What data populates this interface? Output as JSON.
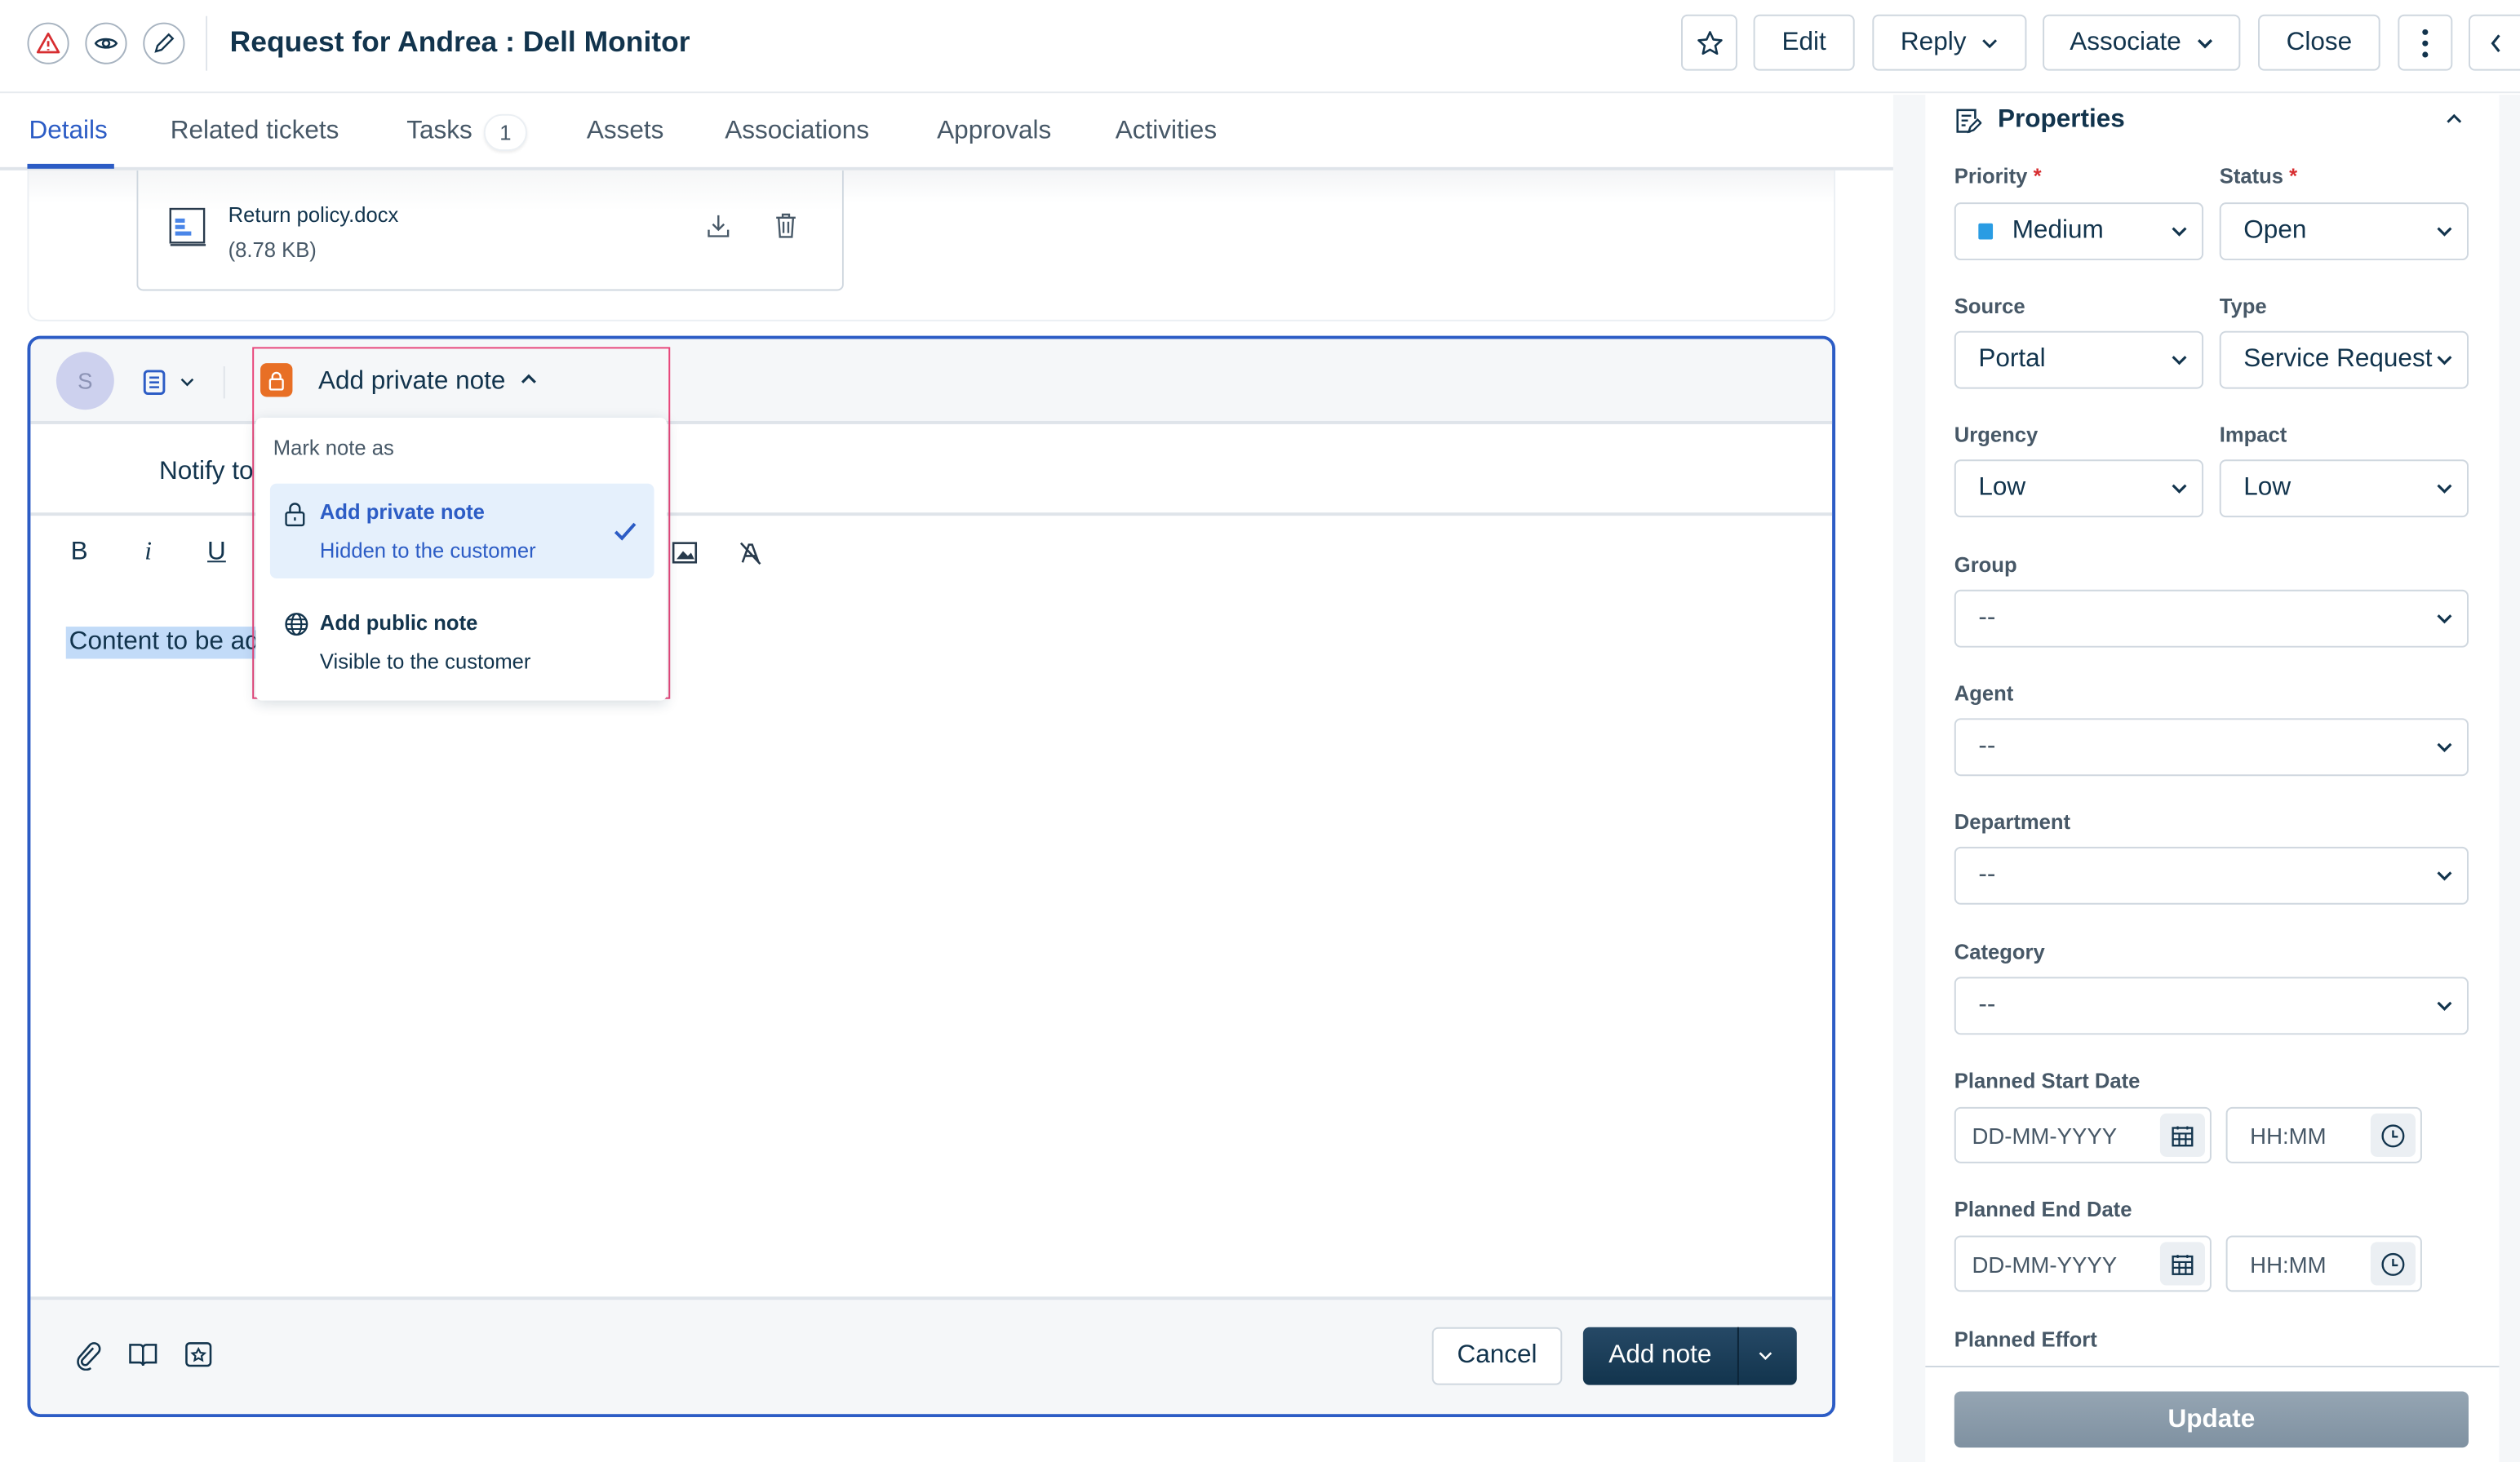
{
  "header": {
    "title": "Request for Andrea : Dell Monitor",
    "buttons": {
      "edit": "Edit",
      "reply": "Reply",
      "associate": "Associate",
      "close": "Close"
    }
  },
  "tabs": [
    {
      "label": "Details",
      "active": true
    },
    {
      "label": "Related tickets"
    },
    {
      "label": "Tasks",
      "badge": "1"
    },
    {
      "label": "Assets"
    },
    {
      "label": "Associations"
    },
    {
      "label": "Approvals"
    },
    {
      "label": "Activities"
    }
  ],
  "attachment": {
    "name": "Return policy.docx",
    "size": "(8.78 KB)"
  },
  "editor": {
    "avatar_initial": "S",
    "note_type_label": "Add private note",
    "notify_label": "Notify to",
    "content": "Content to be ad",
    "toolbar": {
      "bold": "B",
      "italic": "i",
      "underline": "U"
    },
    "dropdown": {
      "heading": "Mark note as",
      "options": [
        {
          "title": "Add private note",
          "subtitle": "Hidden to the customer",
          "selected": true,
          "icon": "lock-icon"
        },
        {
          "title": "Add public note",
          "subtitle": "Visible to the customer",
          "selected": false,
          "icon": "globe-icon"
        }
      ]
    },
    "cancel_label": "Cancel",
    "submit_label": "Add note"
  },
  "properties": {
    "title": "Properties",
    "fields": {
      "priority": {
        "label": "Priority",
        "value": "Medium",
        "color": "#2a9ce3"
      },
      "status": {
        "label": "Status",
        "value": "Open"
      },
      "source": {
        "label": "Source",
        "value": "Portal"
      },
      "type": {
        "label": "Type",
        "value": "Service Request"
      },
      "urgency": {
        "label": "Urgency",
        "value": "Low"
      },
      "impact": {
        "label": "Impact",
        "value": "Low"
      },
      "group": {
        "label": "Group",
        "value": "--"
      },
      "agent": {
        "label": "Agent",
        "value": "--"
      },
      "department": {
        "label": "Department",
        "value": "--"
      },
      "category": {
        "label": "Category",
        "value": "--"
      },
      "planned_start": {
        "label": "Planned Start Date",
        "date_placeholder": "DD-MM-YYYY",
        "time_placeholder": "HH:MM"
      },
      "planned_end": {
        "label": "Planned End Date",
        "date_placeholder": "DD-MM-YYYY",
        "time_placeholder": "HH:MM"
      },
      "planned_effort": {
        "label": "Planned Effort"
      }
    },
    "update_label": "Update"
  },
  "colors": {
    "accent": "#2c5cc5",
    "primary_dark": "#12344d",
    "highlight_outline": "#e8457a",
    "private_note": "#e86f25"
  }
}
